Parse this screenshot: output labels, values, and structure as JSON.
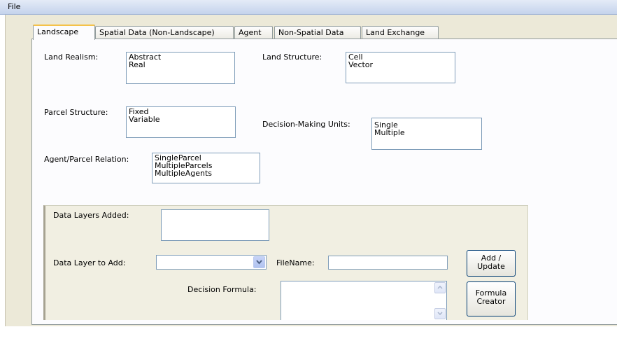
{
  "menubar": {
    "file_label": "File"
  },
  "tabs": [
    {
      "label": "Landscape",
      "active": true
    },
    {
      "label": "Spatial Data (Non-Landscape)",
      "active": false
    },
    {
      "label": "Agent",
      "active": false
    },
    {
      "label": "Non-Spatial Data",
      "active": false
    },
    {
      "label": "Land Exchange",
      "active": false
    }
  ],
  "landscape": {
    "land_realism": {
      "label": "Land Realism:",
      "items": [
        "Abstract",
        "Real"
      ]
    },
    "land_structure": {
      "label": "Land Structure:",
      "items": [
        "Cell",
        "Vector"
      ]
    },
    "parcel_structure": {
      "label": "Parcel Structure:",
      "items": [
        "Fixed",
        "Variable"
      ]
    },
    "decision_units": {
      "label": "Decision-Making Units:",
      "items": [
        "Single",
        "Multiple"
      ]
    },
    "agent_parcel": {
      "label": "Agent/Parcel Relation:",
      "items": [
        "SingleParcel",
        "MultipleParcels",
        "MultipleAgents"
      ]
    }
  },
  "data_layers": {
    "added_label": "Data Layers Added:",
    "to_add_label": "Data Layer to Add:",
    "to_add_value": "",
    "filename_label": "FileName:",
    "filename_value": "",
    "formula_label": "Decision Formula:",
    "formula_value": "",
    "add_update_button": "Add / Update",
    "formula_creator_button": "Formula Creator"
  },
  "colors": {
    "tab_highlight": "#f5c24a",
    "control_border": "#7f9db9",
    "button_border": "#003c74"
  }
}
